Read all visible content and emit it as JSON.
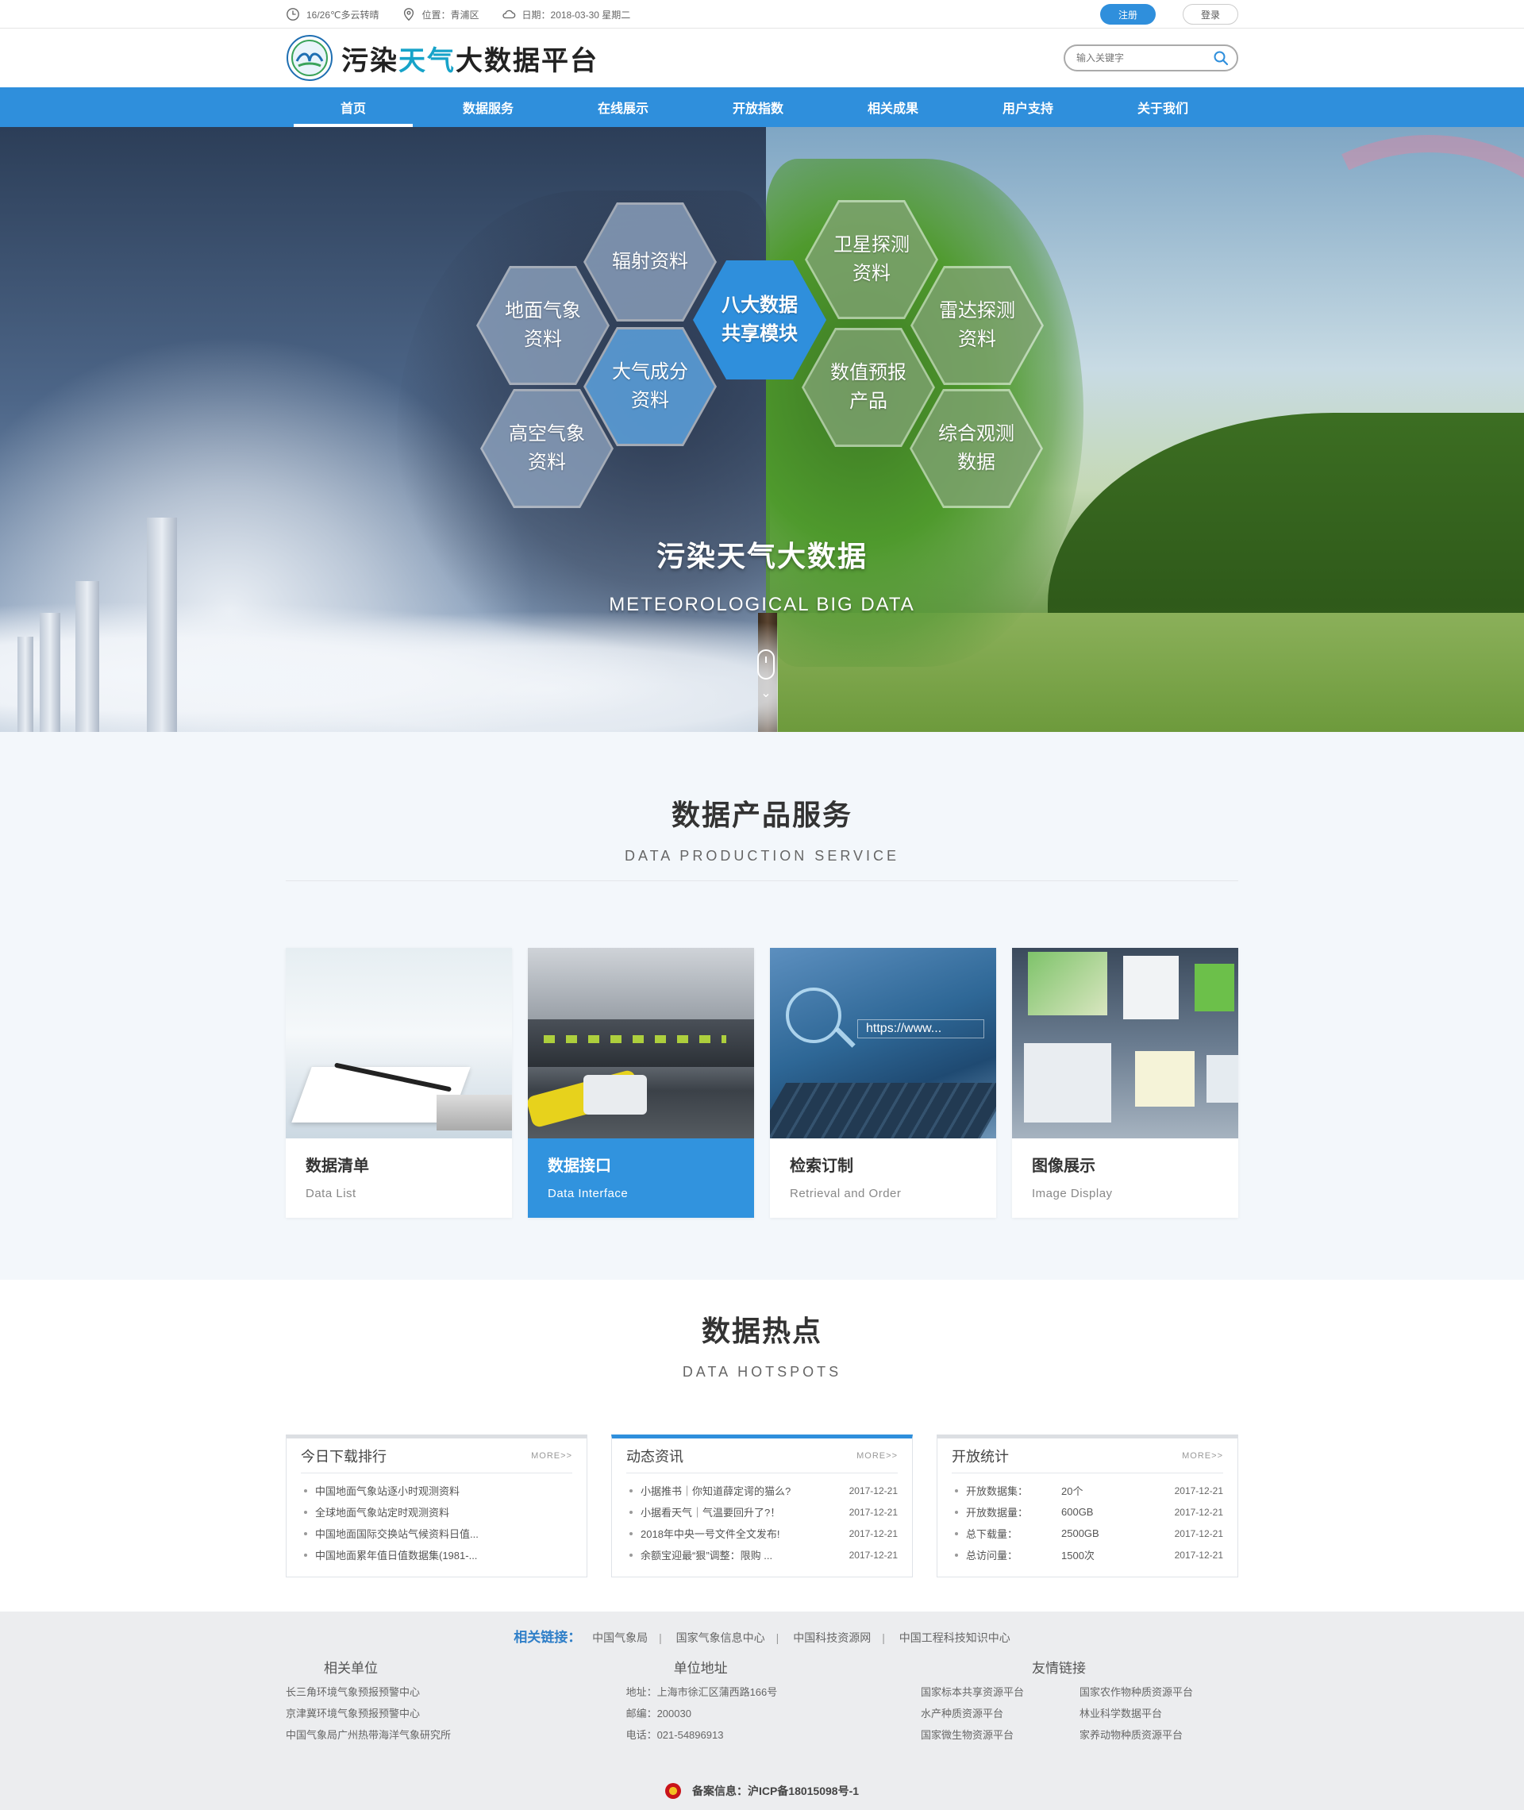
{
  "topbar": {
    "weather": "16/26℃多云转晴",
    "location": "位置：青浦区",
    "date": "日期：2018-03-30 星期二",
    "register": "注册",
    "login": "登录"
  },
  "header": {
    "logo_part1": "污染",
    "logo_part2": "天气",
    "logo_part3": "大数据平台",
    "search_placeholder": "输入关键字"
  },
  "nav": {
    "items": [
      {
        "label": "首页",
        "active": true
      },
      {
        "label": "数据服务"
      },
      {
        "label": "在线展示"
      },
      {
        "label": "开放指数"
      },
      {
        "label": "相关成果"
      },
      {
        "label": "用户支持"
      },
      {
        "label": "关于我们"
      }
    ]
  },
  "banner": {
    "hexes": [
      {
        "label": "辐射资料"
      },
      {
        "label": "地面气象\n资料"
      },
      {
        "label": "大气成分\n资料"
      },
      {
        "label": "高空气象\n资料"
      },
      {
        "label": "八大数据\n共享模块"
      },
      {
        "label": "卫星探测\n资料"
      },
      {
        "label": "雷达探测\n资料"
      },
      {
        "label": "数值预报\n产品"
      },
      {
        "label": "综合观测\n数据"
      }
    ],
    "title_cn": "污染天气大数据",
    "title_en": "METEOROLOGICAL BIG DATA"
  },
  "service": {
    "title_cn": "数据产品服务",
    "title_en": "DATA PRODUCTION SERVICE",
    "cards": [
      {
        "cn": "数据清单",
        "en": "Data List"
      },
      {
        "cn": "数据接口",
        "en": "Data Interface",
        "active": true
      },
      {
        "cn": "检索订制",
        "en": "Retrieval and Order",
        "screen_text": "https://www..."
      },
      {
        "cn": "图像展示",
        "en": "Image Display"
      }
    ]
  },
  "hot": {
    "title_cn": "数据热点",
    "title_en": "DATA HOTSPOTS",
    "more": "MORE>>",
    "panels": [
      {
        "title": "今日下载排行",
        "rows": [
          {
            "text": "中国地面气象站逐小时观测资料"
          },
          {
            "text": "全球地面气象站定时观测资料"
          },
          {
            "text": "中国地面国际交换站气候资料日值..."
          },
          {
            "text": "中国地面累年值日值数据集(1981-..."
          }
        ]
      },
      {
        "title": "动态资讯",
        "rows": [
          {
            "text": "小据推书｜你知道薛定谔的猫么?",
            "date": "2017-12-21"
          },
          {
            "text": "小据看天气｜气温要回升了?！",
            "date": "2017-12-21"
          },
          {
            "text": "2018年中央一号文件全文发布!",
            "date": "2017-12-21"
          },
          {
            "text": "余额宝迎最“狠”调整：限购 ...",
            "date": "2017-12-21"
          }
        ]
      },
      {
        "title": "开放统计",
        "rows": [
          {
            "label": "开放数据集：",
            "value": "20个",
            "date": "2017-12-21"
          },
          {
            "label": "开放数据量：",
            "value": "600GB",
            "date": "2017-12-21"
          },
          {
            "label": "总下载量：",
            "value": "2500GB",
            "date": "2017-12-21"
          },
          {
            "label": "总访问量：",
            "value": "1500次",
            "date": "2017-12-21"
          }
        ]
      }
    ]
  },
  "footer": {
    "links_title": "相关链接：",
    "links": [
      "中国气象局",
      "国家气象信息中心",
      "中国科技资源网",
      "中国工程科技知识中心"
    ],
    "col1_title": "相关单位",
    "col1_items": [
      "长三角环境气象预报预警中心",
      "京津冀环境气象预报预警中心",
      "中国气象局广州热带海洋气象研究所"
    ],
    "col2_title": "单位地址",
    "col2_items": [
      "地址：上海市徐汇区蒲西路166号",
      "邮编：200030",
      "电话：021-54896913"
    ],
    "col3_title": "友情链接",
    "col3_items": [
      "国家标本共享资源平台",
      "国家农作物种质资源平台",
      "水产种质资源平台",
      "林业科学数据平台",
      "国家微生物资源平台",
      "家养动物种质资源平台"
    ],
    "icp": "备案信息：沪ICP备18015098号-1"
  }
}
